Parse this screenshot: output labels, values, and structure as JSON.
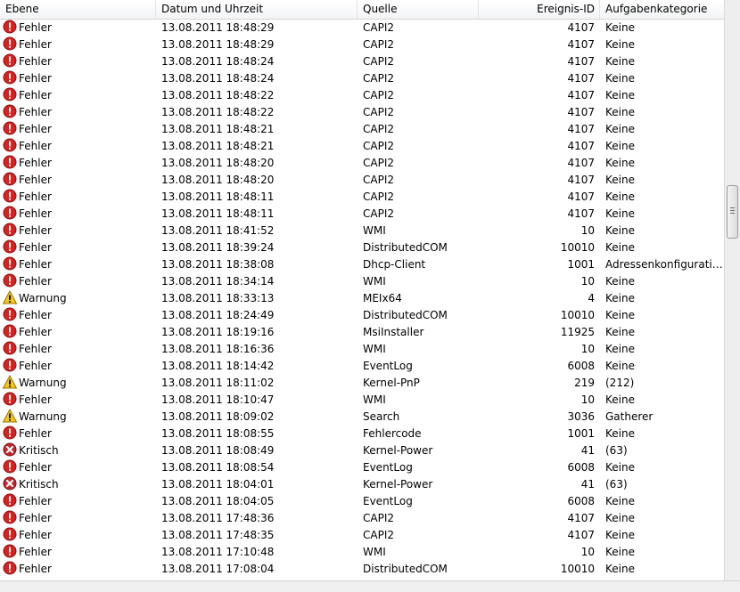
{
  "columns": {
    "level": "Ebene",
    "date": "Datum und Uhrzeit",
    "source": "Quelle",
    "id": "Ereignis-ID",
    "category": "Aufgabenkategorie"
  },
  "colors": {
    "error": "#d7221f",
    "warning": "#f5c816",
    "critical": "#c0272d"
  },
  "events": [
    {
      "level": "Fehler",
      "icon": "error-icon",
      "date": "13.08.2011 18:48:29",
      "source": "CAPI2",
      "id": "4107",
      "category": "Keine"
    },
    {
      "level": "Fehler",
      "icon": "error-icon",
      "date": "13.08.2011 18:48:29",
      "source": "CAPI2",
      "id": "4107",
      "category": "Keine"
    },
    {
      "level": "Fehler",
      "icon": "error-icon",
      "date": "13.08.2011 18:48:24",
      "source": "CAPI2",
      "id": "4107",
      "category": "Keine"
    },
    {
      "level": "Fehler",
      "icon": "error-icon",
      "date": "13.08.2011 18:48:24",
      "source": "CAPI2",
      "id": "4107",
      "category": "Keine"
    },
    {
      "level": "Fehler",
      "icon": "error-icon",
      "date": "13.08.2011 18:48:22",
      "source": "CAPI2",
      "id": "4107",
      "category": "Keine"
    },
    {
      "level": "Fehler",
      "icon": "error-icon",
      "date": "13.08.2011 18:48:22",
      "source": "CAPI2",
      "id": "4107",
      "category": "Keine"
    },
    {
      "level": "Fehler",
      "icon": "error-icon",
      "date": "13.08.2011 18:48:21",
      "source": "CAPI2",
      "id": "4107",
      "category": "Keine"
    },
    {
      "level": "Fehler",
      "icon": "error-icon",
      "date": "13.08.2011 18:48:21",
      "source": "CAPI2",
      "id": "4107",
      "category": "Keine"
    },
    {
      "level": "Fehler",
      "icon": "error-icon",
      "date": "13.08.2011 18:48:20",
      "source": "CAPI2",
      "id": "4107",
      "category": "Keine"
    },
    {
      "level": "Fehler",
      "icon": "error-icon",
      "date": "13.08.2011 18:48:20",
      "source": "CAPI2",
      "id": "4107",
      "category": "Keine"
    },
    {
      "level": "Fehler",
      "icon": "error-icon",
      "date": "13.08.2011 18:48:11",
      "source": "CAPI2",
      "id": "4107",
      "category": "Keine"
    },
    {
      "level": "Fehler",
      "icon": "error-icon",
      "date": "13.08.2011 18:48:11",
      "source": "CAPI2",
      "id": "4107",
      "category": "Keine"
    },
    {
      "level": "Fehler",
      "icon": "error-icon",
      "date": "13.08.2011 18:41:52",
      "source": "WMI",
      "id": "10",
      "category": "Keine"
    },
    {
      "level": "Fehler",
      "icon": "error-icon",
      "date": "13.08.2011 18:39:24",
      "source": "DistributedCOM",
      "id": "10010",
      "category": "Keine"
    },
    {
      "level": "Fehler",
      "icon": "error-icon",
      "date": "13.08.2011 18:38:08",
      "source": "Dhcp-Client",
      "id": "1001",
      "category": "Adressenkonfiguratio..."
    },
    {
      "level": "Fehler",
      "icon": "error-icon",
      "date": "13.08.2011 18:34:14",
      "source": "WMI",
      "id": "10",
      "category": "Keine"
    },
    {
      "level": "Warnung",
      "icon": "warning-icon",
      "date": "13.08.2011 18:33:13",
      "source": "MEIx64",
      "id": "4",
      "category": "Keine"
    },
    {
      "level": "Fehler",
      "icon": "error-icon",
      "date": "13.08.2011 18:24:49",
      "source": "DistributedCOM",
      "id": "10010",
      "category": "Keine"
    },
    {
      "level": "Fehler",
      "icon": "error-icon",
      "date": "13.08.2011 18:19:16",
      "source": "MsiInstaller",
      "id": "11925",
      "category": "Keine"
    },
    {
      "level": "Fehler",
      "icon": "error-icon",
      "date": "13.08.2011 18:16:36",
      "source": "WMI",
      "id": "10",
      "category": "Keine"
    },
    {
      "level": "Fehler",
      "icon": "error-icon",
      "date": "13.08.2011 18:14:42",
      "source": "EventLog",
      "id": "6008",
      "category": "Keine"
    },
    {
      "level": "Warnung",
      "icon": "warning-icon",
      "date": "13.08.2011 18:11:02",
      "source": "Kernel-PnP",
      "id": "219",
      "category": "(212)"
    },
    {
      "level": "Fehler",
      "icon": "error-icon",
      "date": "13.08.2011 18:10:47",
      "source": "WMI",
      "id": "10",
      "category": "Keine"
    },
    {
      "level": "Warnung",
      "icon": "warning-icon",
      "date": "13.08.2011 18:09:02",
      "source": "Search",
      "id": "3036",
      "category": "Gatherer"
    },
    {
      "level": "Fehler",
      "icon": "error-icon",
      "date": "13.08.2011 18:08:55",
      "source": "Fehlercode",
      "id": "1001",
      "category": "Keine"
    },
    {
      "level": "Kritisch",
      "icon": "critical-icon",
      "date": "13.08.2011 18:08:49",
      "source": "Kernel-Power",
      "id": "41",
      "category": "(63)"
    },
    {
      "level": "Fehler",
      "icon": "error-icon",
      "date": "13.08.2011 18:08:54",
      "source": "EventLog",
      "id": "6008",
      "category": "Keine"
    },
    {
      "level": "Kritisch",
      "icon": "critical-icon",
      "date": "13.08.2011 18:04:01",
      "source": "Kernel-Power",
      "id": "41",
      "category": "(63)"
    },
    {
      "level": "Fehler",
      "icon": "error-icon",
      "date": "13.08.2011 18:04:05",
      "source": "EventLog",
      "id": "6008",
      "category": "Keine"
    },
    {
      "level": "Fehler",
      "icon": "error-icon",
      "date": "13.08.2011 17:48:36",
      "source": "CAPI2",
      "id": "4107",
      "category": "Keine"
    },
    {
      "level": "Fehler",
      "icon": "error-icon",
      "date": "13.08.2011 17:48:35",
      "source": "CAPI2",
      "id": "4107",
      "category": "Keine"
    },
    {
      "level": "Fehler",
      "icon": "error-icon",
      "date": "13.08.2011 17:10:48",
      "source": "WMI",
      "id": "10",
      "category": "Keine"
    },
    {
      "level": "Fehler",
      "icon": "error-icon",
      "date": "13.08.2011 17:08:04",
      "source": "DistributedCOM",
      "id": "10010",
      "category": "Keine"
    }
  ]
}
